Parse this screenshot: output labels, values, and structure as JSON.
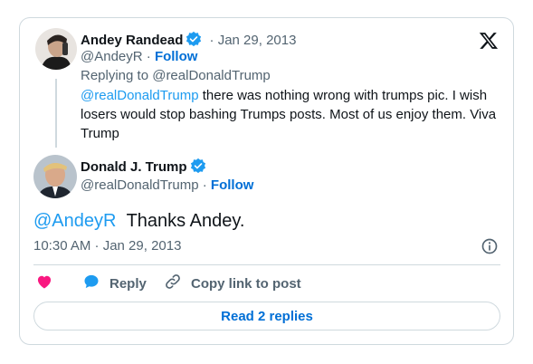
{
  "colors": {
    "accent": "#1d9bf0",
    "link": "#006fd6",
    "muted": "#536471",
    "heart": "#f91880",
    "border": "#cfd9de"
  },
  "reply_tweet": {
    "author_name": "Andey Randead",
    "date": "Jan 29, 2013",
    "handle": "@AndeyR",
    "follow_label": "Follow",
    "replying_to": "Replying to @realDonaldTrump",
    "mention": "@realDonaldTrump",
    "body": " there was nothing wrong with trumps pic. I wish losers would stop bashing Trumps posts. Most of us enjoy them. Viva Trump"
  },
  "main_tweet": {
    "author_name": "Donald J. Trump",
    "handle": "@realDonaldTrump",
    "follow_label": "Follow",
    "mention": "@AndeyR",
    "body": "Thanks Andey.",
    "timestamp": "10:30 AM · Jan 29, 2013"
  },
  "actions": {
    "reply_label": "Reply",
    "copy_label": "Copy link to post"
  },
  "read_replies_label": "Read 2 replies",
  "separator": "·",
  "icons": [
    "x-logo-icon",
    "verified-badge-icon",
    "info-icon",
    "heart-icon",
    "reply-bubble-icon",
    "link-icon"
  ]
}
